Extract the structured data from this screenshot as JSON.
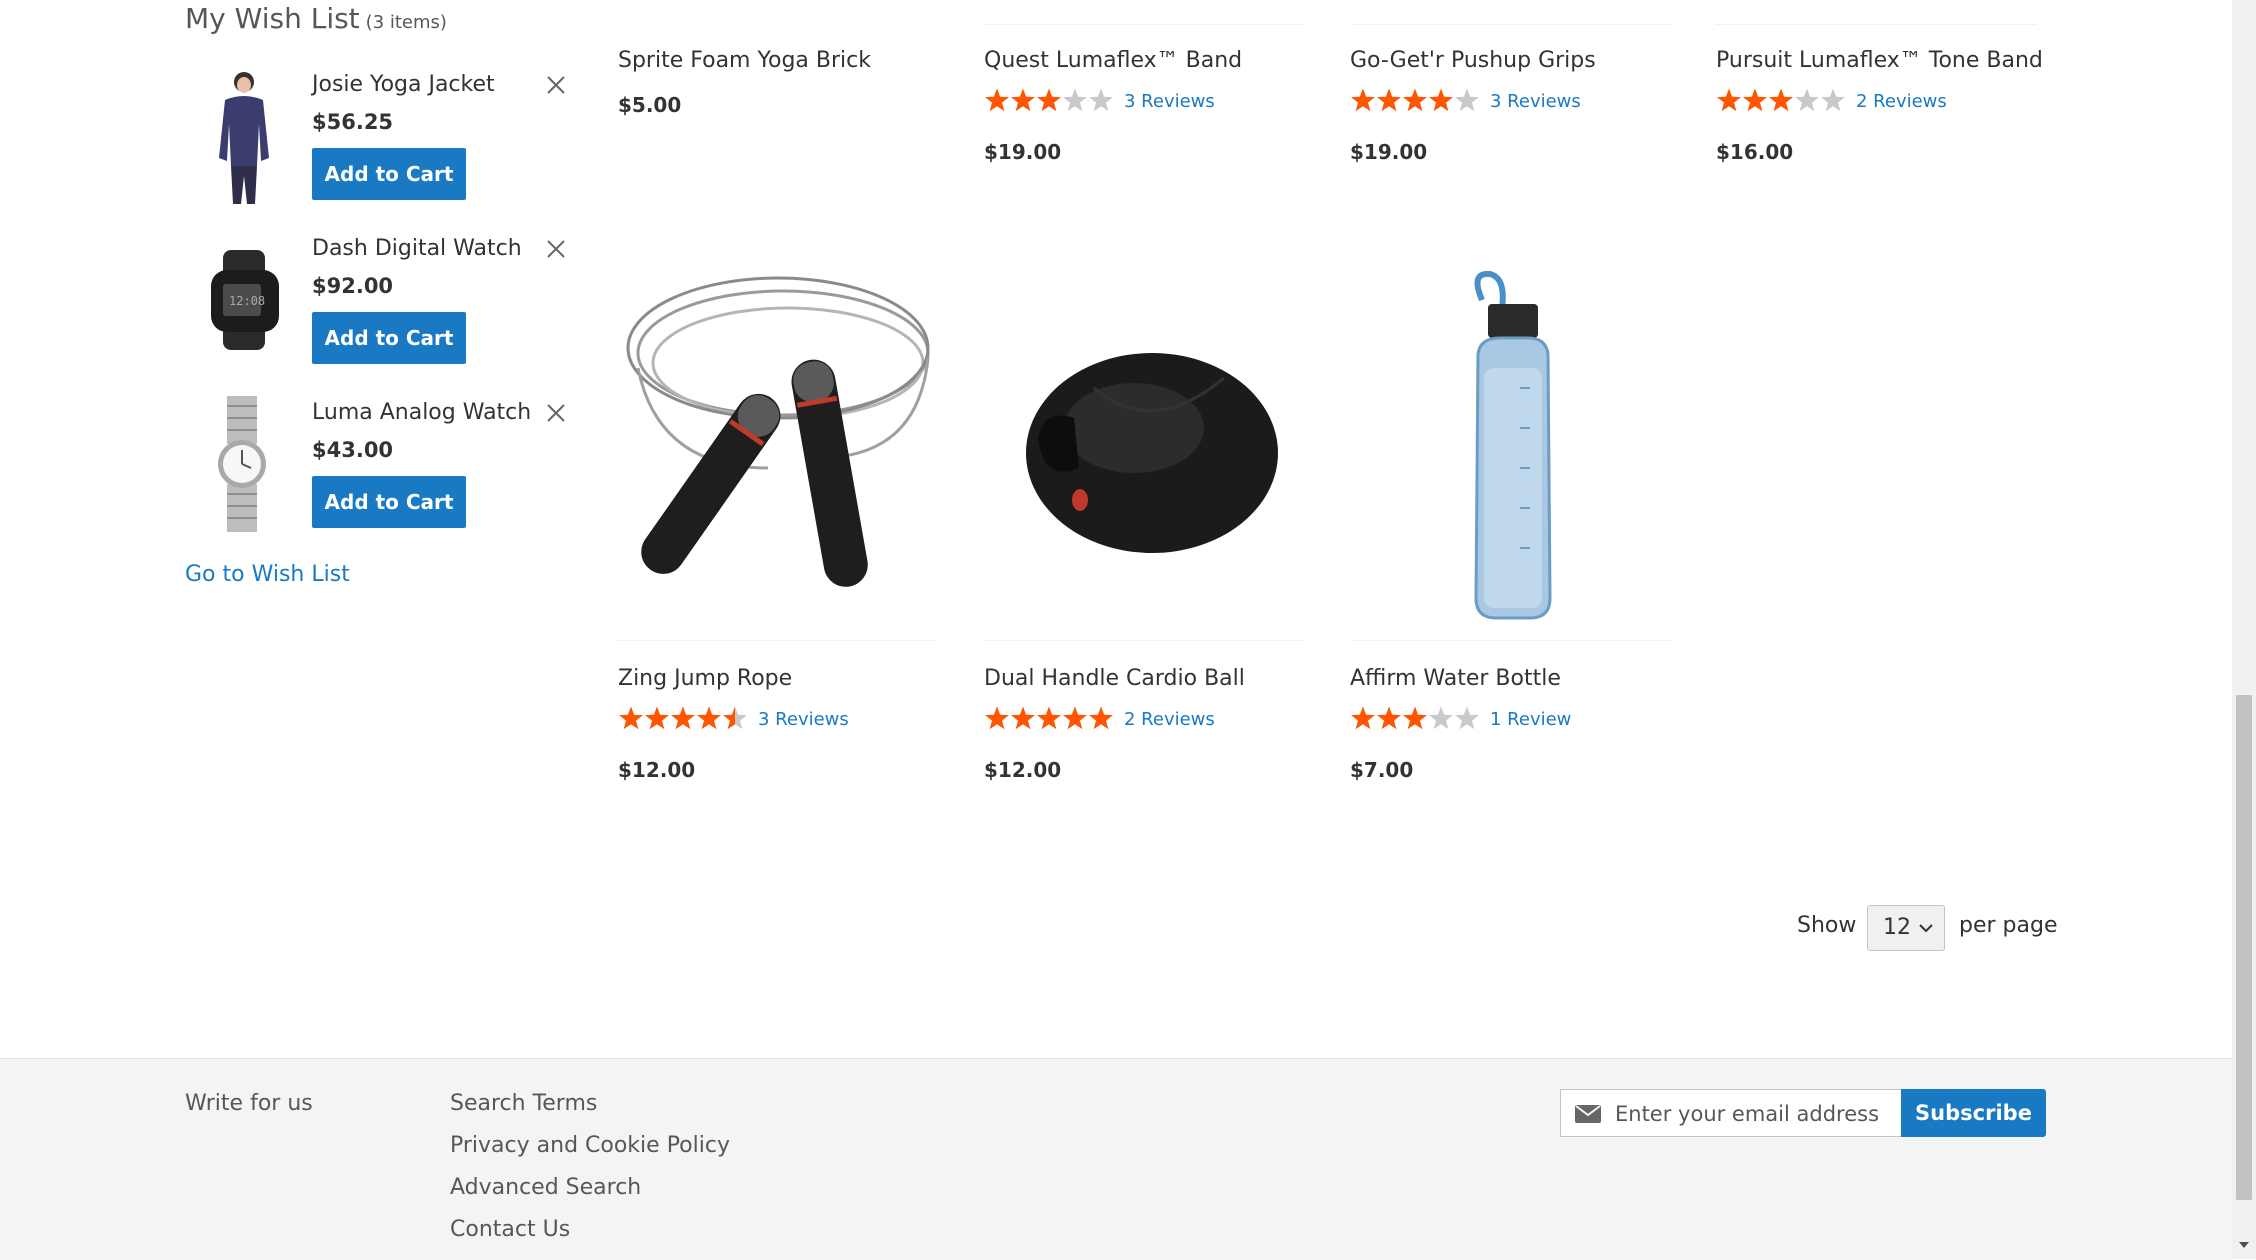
{
  "wishlist": {
    "title": "My Wish List",
    "count": "(3 items)",
    "add_to_cart_label": "Add to Cart",
    "go_to_link": "Go to Wish List",
    "items": [
      {
        "name": "Josie Yoga Jacket",
        "price": "$56.25"
      },
      {
        "name": "Dash Digital Watch",
        "price": "$92.00"
      },
      {
        "name": "Luma Analog Watch",
        "price": "$43.00"
      }
    ]
  },
  "products_top": [
    {
      "name": "Sprite Foam Yoga Brick",
      "price": "$5.00"
    },
    {
      "name": "Quest Lumaflex™ Band",
      "rating": 0.6,
      "reviews": "3 Reviews",
      "price": "$19.00"
    },
    {
      "name": "Go-Get'r Pushup Grips",
      "rating": 0.8,
      "reviews": "3 Reviews",
      "price": "$19.00"
    },
    {
      "name": "Pursuit Lumaflex™ Tone Band",
      "rating": 0.6,
      "reviews": "2 Reviews",
      "price": "$16.00"
    }
  ],
  "products_bottom": [
    {
      "name": "Zing Jump Rope",
      "rating": 0.9,
      "reviews": "3 Reviews",
      "price": "$12.00"
    },
    {
      "name": "Dual Handle Cardio Ball",
      "rating": 1.0,
      "reviews": "2 Reviews",
      "price": "$12.00"
    },
    {
      "name": "Affirm Water Bottle",
      "rating": 0.6,
      "reviews": "1 Review",
      "price": "$7.00"
    }
  ],
  "toolbar": {
    "show_label": "Show",
    "limit_value": "12",
    "per_page_label": "per page"
  },
  "footer": {
    "links_col1": [
      "Write for us"
    ],
    "links_col2": [
      "Search Terms",
      "Privacy and Cookie Policy",
      "Advanced Search",
      "Contact Us"
    ],
    "newsletter_placeholder": "Enter your email address",
    "subscribe_label": "Subscribe"
  },
  "colors": {
    "accent_blue": "#1979c3",
    "star_orange": "#ff5501",
    "star_empty": "#c9c9c9",
    "footer_bg": "#f4f4f4"
  },
  "icons": {
    "remove": "close-icon",
    "star": "star-icon",
    "dropdown": "chevron-down-icon",
    "newsletter": "envelope-icon"
  }
}
